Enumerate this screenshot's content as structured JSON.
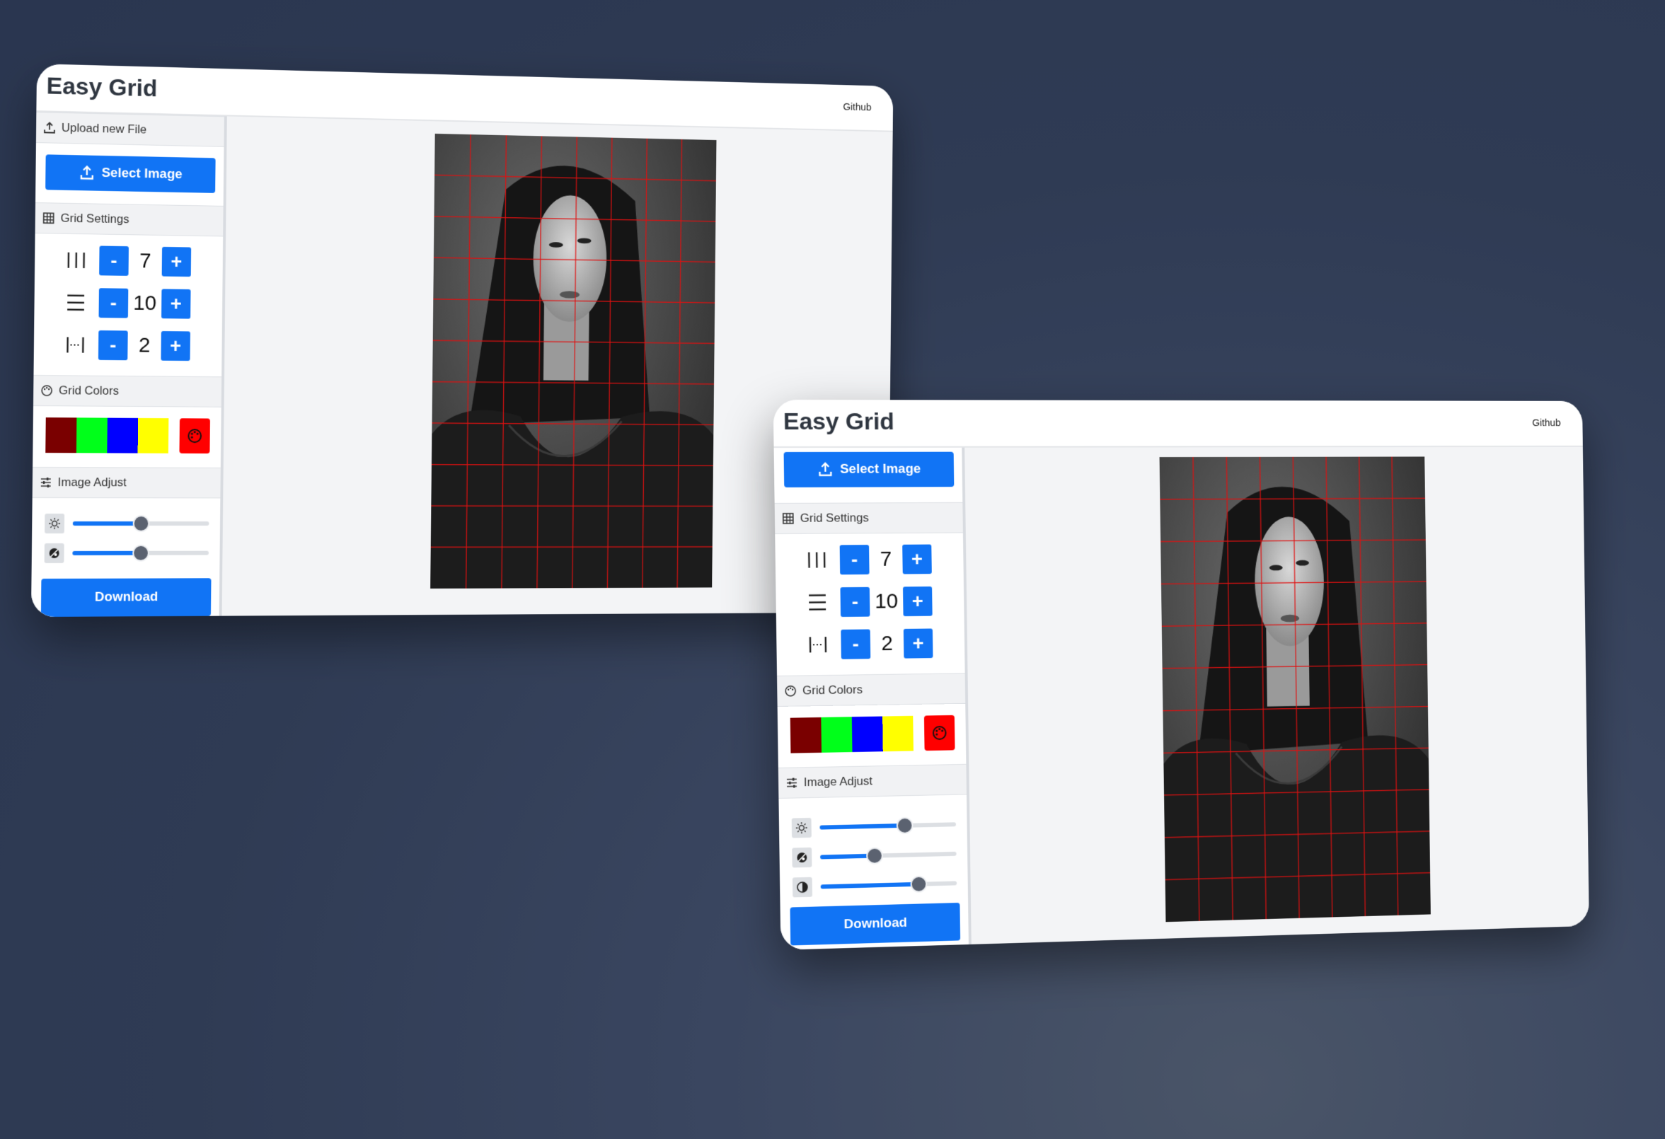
{
  "app": {
    "brand": "Easy Grid",
    "nav_link": "Github"
  },
  "upload": {
    "section_title": "Upload new File",
    "select_label": "Select Image",
    "icon": "upload-icon"
  },
  "grid_settings": {
    "section_title": "Grid Settings",
    "columns": {
      "icon": "columns-icon",
      "value": "7"
    },
    "rows": {
      "icon": "rows-icon",
      "value": "10"
    },
    "line_width": {
      "icon": "line-width-icon",
      "value": "2"
    },
    "minus_label": "-",
    "plus_label": "+"
  },
  "grid_colors": {
    "section_title": "Grid Colors",
    "swatches": [
      "#7a0000",
      "#00ff1a",
      "#0000ff",
      "#ffff00"
    ],
    "picker_color": "#ff0000",
    "picker_icon": "palette-icon"
  },
  "image_adjust": {
    "section_title": "Image Adjust",
    "window1": {
      "brightness": 0.5,
      "saturation": 0.5
    },
    "window2": {
      "brightness": 0.62,
      "saturation": 0.4,
      "contrast": 0.72
    }
  },
  "download_label": "Download",
  "grid_overlay": {
    "color": "#e01010",
    "columns": 7,
    "rows": 10
  }
}
